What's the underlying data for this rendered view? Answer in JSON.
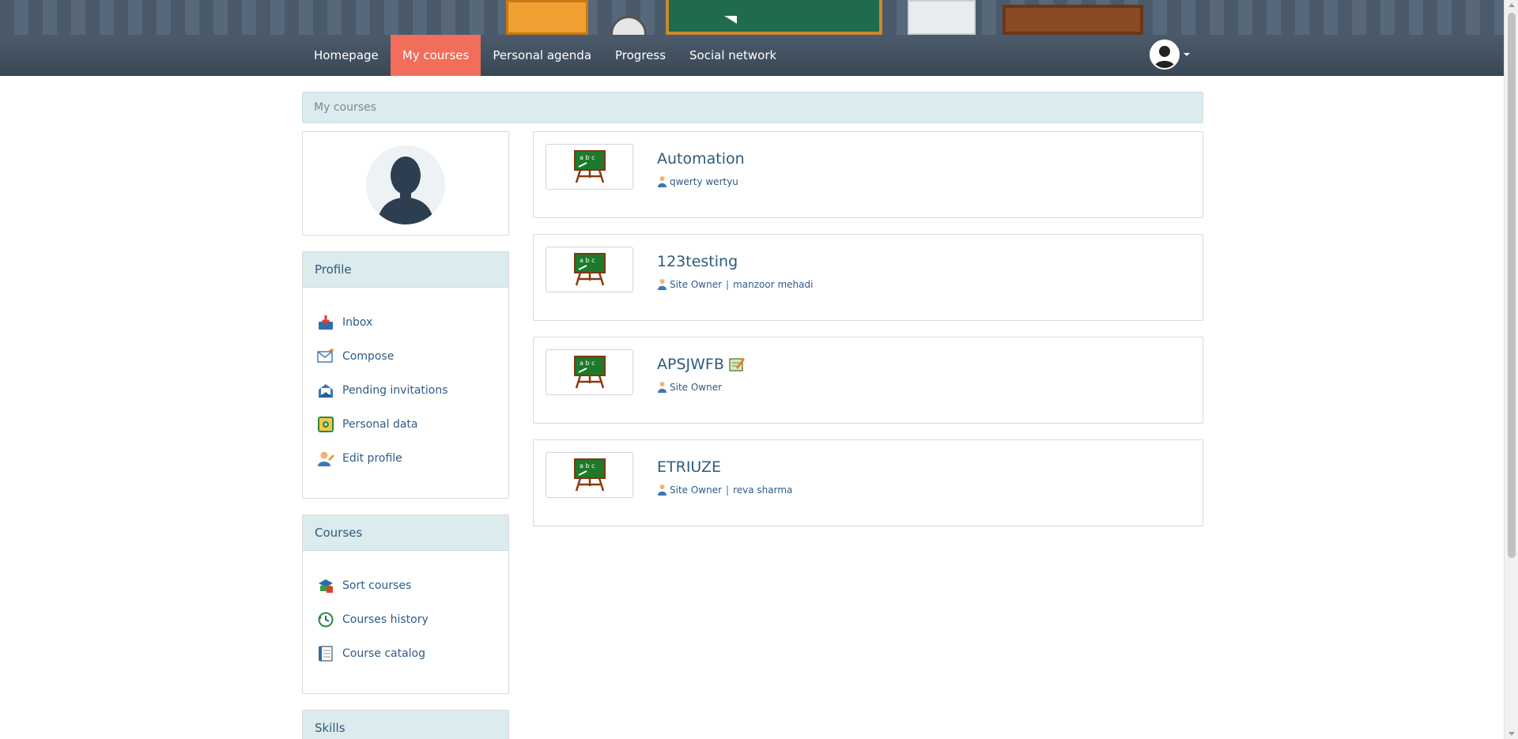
{
  "nav": {
    "items": [
      {
        "label": "Homepage"
      },
      {
        "label": "My courses"
      },
      {
        "label": "Personal agenda"
      },
      {
        "label": "Progress"
      },
      {
        "label": "Social network"
      }
    ],
    "active_item": "My courses",
    "user_icon": "user-avatar-icon"
  },
  "breadcrumb": {
    "label": "My courses"
  },
  "sidebar": {
    "profile": {
      "title": "Profile",
      "items": [
        {
          "label": "Inbox",
          "icon": "inbox-icon"
        },
        {
          "label": "Compose",
          "icon": "compose-icon"
        },
        {
          "label": "Pending invitations",
          "icon": "invitations-icon"
        },
        {
          "label": "Personal data",
          "icon": "personal-data-icon"
        },
        {
          "label": "Edit profile",
          "icon": "edit-profile-icon"
        }
      ]
    },
    "courses": {
      "title": "Courses",
      "items": [
        {
          "label": "Sort courses",
          "icon": "sort-courses-icon"
        },
        {
          "label": "Courses history",
          "icon": "history-icon"
        },
        {
          "label": "Course catalog",
          "icon": "catalog-icon"
        }
      ]
    },
    "skills": {
      "title": "Skills"
    }
  },
  "courses": [
    {
      "title": "Automation",
      "teachers": [
        "qwerty wertyu"
      ]
    },
    {
      "title": "123testing",
      "teachers": [
        "Site Owner",
        "manzoor mehadi"
      ]
    },
    {
      "title": "APSJWFB",
      "teachers": [
        "Site Owner"
      ],
      "has_edit_icon": true
    },
    {
      "title": "ETRIUZE",
      "teachers": [
        "Site Owner",
        "reva sharma"
      ]
    }
  ],
  "colors": {
    "nav_bg": "#3f4d5b",
    "nav_active": "#f06e5a",
    "panel_head_bg": "#dcebee",
    "link": "#2f5b87"
  }
}
